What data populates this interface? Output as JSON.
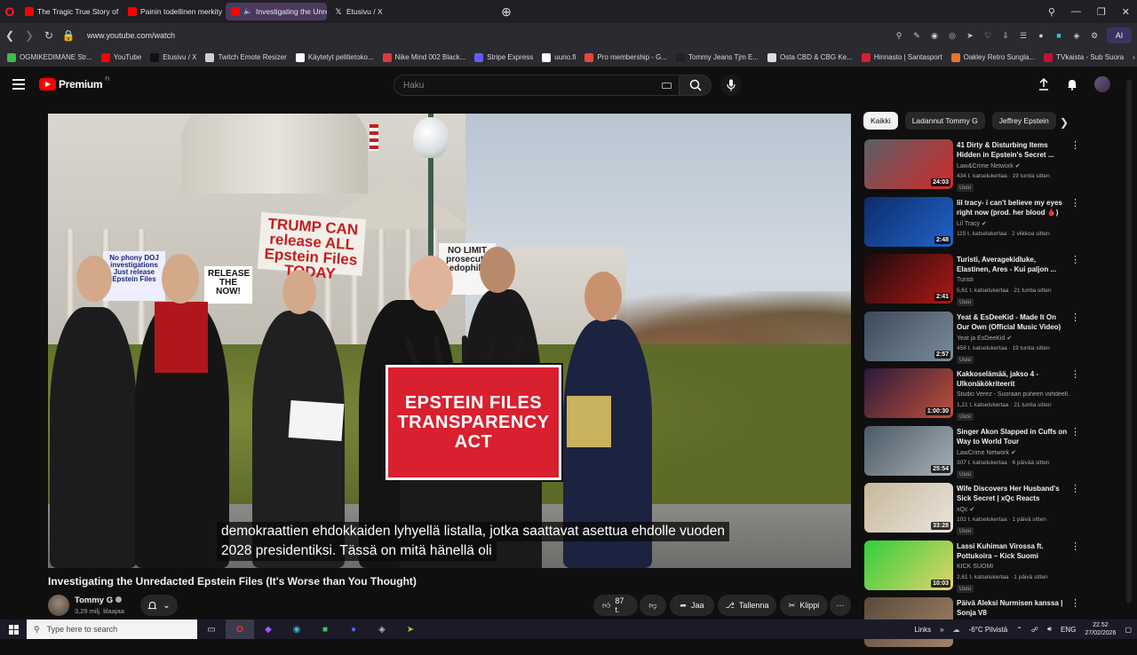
{
  "browser": {
    "tabs": [
      {
        "title": "The Tragic True Story of Ju",
        "icon": "youtube-icon",
        "active": false
      },
      {
        "title": "Painin todellinen merkity",
        "icon": "youtube-icon",
        "active": false
      },
      {
        "title": "Investigating the Unre",
        "icon": "youtube-icon",
        "active": true
      },
      {
        "title": "Etusivu / X",
        "icon": "x-icon",
        "active": false
      }
    ],
    "url": "www.youtube.com/watch",
    "ai_label": "AI",
    "bookmarks": [
      {
        "label": "OGMIKEDIMANE Str...",
        "color": "#3dbb4a"
      },
      {
        "label": "YouTube",
        "color": "#ff0000"
      },
      {
        "label": "Etusivu / X",
        "color": "#111111"
      },
      {
        "label": "Twitch Emote Resizer",
        "color": "#cfcfcf"
      },
      {
        "label": "Käytetyt pelitietoko...",
        "color": "#ffffff"
      },
      {
        "label": "Nike Mind 002 Black...",
        "color": "#e03a3a"
      },
      {
        "label": "Stripe Express",
        "color": "#635bff"
      },
      {
        "label": "uuno.fi",
        "color": "#ffffff"
      },
      {
        "label": "Pro membership - G...",
        "color": "#e8453c"
      },
      {
        "label": "Tommy Jeans Tjm E...",
        "color": "#222222"
      },
      {
        "label": "Osta CBD & CBG Ke...",
        "color": "#dddddd"
      },
      {
        "label": "Hinnasto | Santasport",
        "color": "#d6202f"
      },
      {
        "label": "Oakley Retro Sungla...",
        "color": "#e8742c"
      },
      {
        "label": "TVkaista - Sub Suora",
        "color": "#c8102e"
      }
    ]
  },
  "youtube": {
    "logo_text": "Premium",
    "logo_region": "FI",
    "search_placeholder": "Haku"
  },
  "video": {
    "podium_text_line1": "EPSTEIN FILES",
    "podium_text_line2": "TRANSPARENCY ACT",
    "sign_1": "TRUMP CAN release ALL Epstein Files TODAY",
    "sign_2": "No phony DOJ investigations Just release Epstein Files",
    "sign_3": "RELEASE THE NOW!",
    "sign_4": "NO LIMIT prosecute pedophiles",
    "subtitle_line1": "demokraattien ehdokkaiden lyhyellä listalla, jotka saattavat asettua ehdolle vuoden",
    "subtitle_line2": "2028 presidentiksi. Tässä on mitä hänellä oli",
    "title": "Investigating the Unredacted Epstein Files (It's Worse than You Thought)",
    "channel_name": "Tommy G",
    "subscribers": "3,29 milj. tilaajaa",
    "likes": "87 t.",
    "share_label": "Jaa",
    "save_label": "Tallenna",
    "clip_label": "Klippi"
  },
  "chips": [
    "Kaikki",
    "Ladannut Tommy G",
    "Jeffrey Epstein"
  ],
  "recommendations": [
    {
      "title": "41 Dirty & Disturbing Items Hidden in Epstein's Secret ...",
      "channel": "Law&Crime Network",
      "verified": true,
      "meta": "434 t. katselukertaa · 19 tuntia sitten",
      "badge": "Uusi",
      "duration": "24:03",
      "colors": [
        "#5a5f66",
        "#d22a2a"
      ]
    },
    {
      "title": "lil tracy- i can't believe my eyes right now (prod. her blood 🩸)",
      "channel": "Lil Tracy",
      "verified": true,
      "meta": "115 t. katselukertaa · 2 viikkoa sitten",
      "badge": "",
      "duration": "2:48",
      "colors": [
        "#0e2b6b",
        "#1f64c8"
      ]
    },
    {
      "title": "Turisti, Averagekidluke, Elastinen, Ares - Kui paljon ...",
      "channel": "Turisti",
      "verified": false,
      "meta": "5,61 t. katselukertaa · 21 tuntia sitten",
      "badge": "Uusi",
      "duration": "2:41",
      "colors": [
        "#1a0b0b",
        "#b01818"
      ]
    },
    {
      "title": "Yeat & EsDeeKid - Made It On Our Own (Official Music Video)",
      "channel": "Yeat ja EsDeeKid",
      "verified": true,
      "meta": "458 t. katselukertaa · 19 tuntia sitten",
      "badge": "Uusi",
      "duration": "2:57",
      "colors": [
        "#3a4a5a",
        "#7d8c99"
      ]
    },
    {
      "title": "Kakkoselämää, jakso 4 - Ulkonäkökriteerit",
      "channel": "Studio Verez - Suoraan puheen viihdeell...",
      "verified": false,
      "meta": "1,21 t. katselukertaa · 21 tuntia sitten",
      "badge": "Uusi",
      "duration": "1:00:30",
      "colors": [
        "#2a1a3a",
        "#c0503a"
      ]
    },
    {
      "title": "Singer Akon Slapped in Cuffs on Way to World Tour",
      "channel": "LawCrime Network",
      "verified": true,
      "meta": "307 t. katselukertaa · 6 päivää sitten",
      "badge": "Uusi",
      "duration": "25:54",
      "colors": [
        "#4a5a66",
        "#a8b0b6"
      ]
    },
    {
      "title": "Wife Discovers Her Husband's Sick Secret | xQc Reacts",
      "channel": "xQc",
      "verified": true,
      "meta": "102 t. katselukertaa · 1 päivä sitten",
      "badge": "Uusi",
      "duration": "33:28",
      "colors": [
        "#c8b89a",
        "#e9e4dc"
      ]
    },
    {
      "title": "Lassi Kuhiman Virossa ft. Pottukoira – Kick Suomi",
      "channel": "KICK SUOMI",
      "verified": false,
      "meta": "2,61 t. katselukertaa · 1 päivä sitten",
      "badge": "Uusi",
      "duration": "10:03",
      "colors": [
        "#2fcf3a",
        "#e4d36a"
      ]
    },
    {
      "title": "Päivä Aleksi Nurmisen kanssa | Sonja V8",
      "channel": "",
      "verified": false,
      "meta": "",
      "badge": "",
      "duration": "",
      "colors": [
        "#5a4a3a",
        "#a0826a"
      ]
    }
  ],
  "taskbar": {
    "search_placeholder": "Type here to search",
    "links_label": "Links",
    "weather": "-6°C  Pilvistä",
    "language": "ENG",
    "time": "22.52",
    "date": "27/02/2026"
  }
}
